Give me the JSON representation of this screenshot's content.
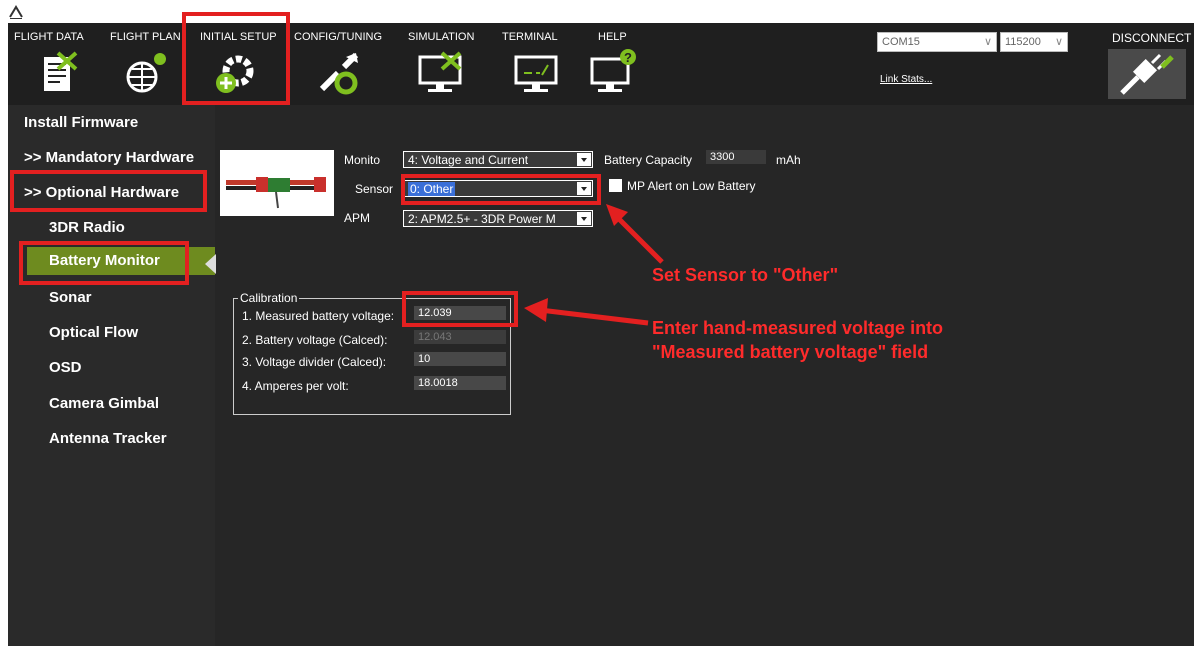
{
  "menu": [
    {
      "label": "FLIGHT DATA",
      "icon": "flight-data-icon"
    },
    {
      "label": "FLIGHT PLAN",
      "icon": "flight-plan-icon"
    },
    {
      "label": "INITIAL SETUP",
      "icon": "initial-setup-icon"
    },
    {
      "label": "CONFIG/TUNING",
      "icon": "config-tuning-icon"
    },
    {
      "label": "SIMULATION",
      "icon": "simulation-icon"
    },
    {
      "label": "TERMINAL",
      "icon": "terminal-icon"
    },
    {
      "label": "HELP",
      "icon": "help-icon"
    }
  ],
  "connection": {
    "port": "COM15",
    "baud": "115200",
    "link_stats": "Link Stats...",
    "disconnect_label": "DISCONNECT"
  },
  "sidebar": {
    "items": [
      {
        "label": "Install Firmware"
      },
      {
        "label": ">> Mandatory Hardware"
      },
      {
        "label": ">> Optional Hardware"
      },
      {
        "label": "3DR Radio"
      },
      {
        "label": "Battery Monitor"
      },
      {
        "label": "Sonar"
      },
      {
        "label": "Optical Flow"
      },
      {
        "label": "OSD"
      },
      {
        "label": "Camera Gimbal"
      },
      {
        "label": "Antenna Tracker"
      }
    ],
    "selected": "Battery Monitor"
  },
  "battery": {
    "monitor_label": "Monito",
    "monitor_value": "4: Voltage and Current",
    "sensor_label": "Sensor",
    "sensor_value": "0: Other",
    "apm_label": "APM",
    "apm_value": "2: APM2.5+ - 3DR Power M",
    "capacity_label": "Battery Capacity",
    "capacity_value": "3300",
    "capacity_unit": "mAh",
    "alert_label": "MP Alert on Low Battery"
  },
  "calibration": {
    "title": "Calibration",
    "rows": [
      {
        "label": "1. Measured battery voltage:",
        "value": "12.039"
      },
      {
        "label": "2. Battery voltage (Calced):",
        "value": "12.043"
      },
      {
        "label": "3. Voltage divider (Calced):",
        "value": "10"
      },
      {
        "label": "4. Amperes per volt:",
        "value": "18.0018"
      }
    ]
  },
  "annotations": {
    "sensor_note": "Set Sensor to \"Other\"",
    "voltage_note_line1": "Enter hand-measured voltage into",
    "voltage_note_line2": "\"Measured battery voltage\" field"
  },
  "colors": {
    "accent_red": "#e32020",
    "selected_green": "#6e8b1f"
  }
}
